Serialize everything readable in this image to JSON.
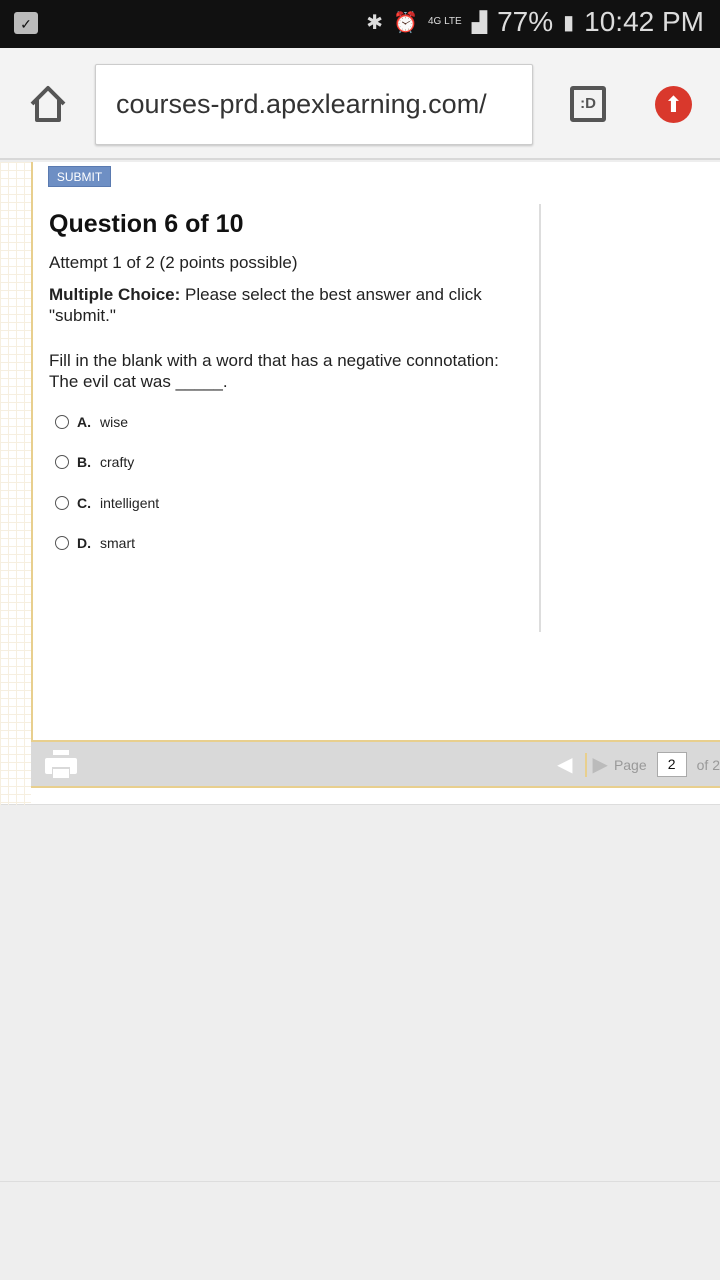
{
  "status_bar": {
    "battery": "77%",
    "time": "10:42 PM",
    "network": "4G LTE"
  },
  "browser": {
    "url": "courses-prd.apexlearning.com/",
    "tabs_label": ":D"
  },
  "quiz": {
    "submit_label": "SUBMIT",
    "title": "Question 6 of 10",
    "attempt": "Attempt 1 of 2 (2 points possible)",
    "instruction_bold": "Multiple Choice:",
    "instruction_text": " Please select the best answer and click \"submit.\"",
    "prompt_line1": "Fill in the blank with a word that has a negative connotation:",
    "prompt_line2": "The evil cat was _____.",
    "options": [
      {
        "letter": "A.",
        "text": "wise"
      },
      {
        "letter": "B.",
        "text": "crafty"
      },
      {
        "letter": "C.",
        "text": "intelligent"
      },
      {
        "letter": "D.",
        "text": "smart"
      }
    ]
  },
  "footer": {
    "page_label": "Page",
    "page_value": "2",
    "of_label": "of 2"
  },
  "colors": {
    "accent": "#6e8fc4",
    "frame": "#e8cf8e",
    "update": "#d9382c"
  }
}
